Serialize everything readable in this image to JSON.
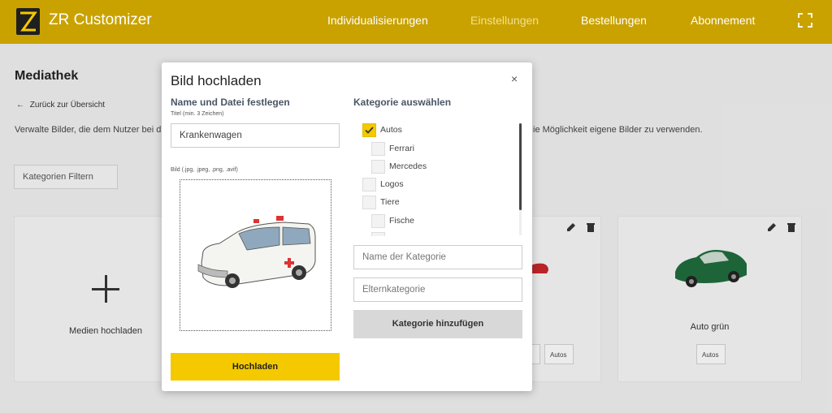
{
  "header": {
    "app_title": "ZR Customizer",
    "nav": [
      "Individualisierungen",
      "Einstellungen",
      "Bestellungen",
      "Abonnement"
    ],
    "active_nav": "Einstellungen",
    "logo_icon": "zr-logo-icon",
    "expand_icon": "fullscreen-icon"
  },
  "page": {
    "heading": "Mediathek",
    "back_link": "Zurück zur Übersicht",
    "description_left": "Verwalte Bilder, die dem Nutzer bei d",
    "description_right": "ie Möglichkeit eigene Bilder zu verwenden.",
    "filter_button": "Kategorien Filtern",
    "upload_card_label": "Medien hochladen",
    "card_mid_tag_left": "s",
    "card_mid_tag": "Autos",
    "card_right_label": "Auto grün",
    "card_right_tag": "Autos"
  },
  "modal": {
    "title": "Bild hochladen",
    "close": "×",
    "left_heading": "Name und Datei festlegen",
    "title_hint": "Titel (min. 3 Zeichen)",
    "title_value": "Krankenwagen",
    "file_hint": "Bild (.jpg, .jpeg, .png, .avif)",
    "upload_button": "Hochladen",
    "right_heading": "Kategorie auswählen",
    "categories": [
      {
        "label": "Autos",
        "checked": true,
        "level": 0
      },
      {
        "label": "Ferrari",
        "checked": false,
        "level": 1
      },
      {
        "label": "Mercedes",
        "checked": false,
        "level": 1
      },
      {
        "label": "Logos",
        "checked": false,
        "level": 0
      },
      {
        "label": "Tiere",
        "checked": false,
        "level": 0
      },
      {
        "label": "Fische",
        "checked": false,
        "level": 1
      },
      {
        "label": "",
        "checked": false,
        "level": 1
      }
    ],
    "category_name_placeholder": "Name der Kategorie",
    "parent_category_placeholder": "Elternkategorie",
    "add_category_button": "Kategorie hinzufügen"
  },
  "colors": {
    "header_bg": "#c9a200",
    "accent": "#f4c900",
    "page_bg": "#e9e9e9"
  }
}
